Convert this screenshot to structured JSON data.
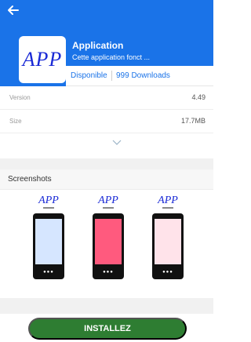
{
  "header": {
    "back_icon": "arrow-left-icon",
    "app_icon_text": "APP",
    "app_name": "Application",
    "app_description": "Cette application fonct ..."
  },
  "meta": {
    "availability": "Disponible",
    "downloads": "999 Downloads"
  },
  "info": {
    "rows": [
      {
        "key": "Version",
        "value": "4.49"
      },
      {
        "key": "Size",
        "value": "17.7MB"
      }
    ],
    "expand_icon": "chevron-down-icon"
  },
  "screenshots": {
    "title": "Screenshots",
    "items": [
      {
        "label": "APP",
        "screen_color": "#d6e6ff"
      },
      {
        "label": "APP",
        "screen_color": "#ff5a7e"
      },
      {
        "label": "APP",
        "screen_color": "#ffe3ea"
      }
    ]
  },
  "install_button": {
    "label": "INSTALLEZ",
    "color": "#2e7d32"
  },
  "colors": {
    "primary": "#1a73e8"
  }
}
